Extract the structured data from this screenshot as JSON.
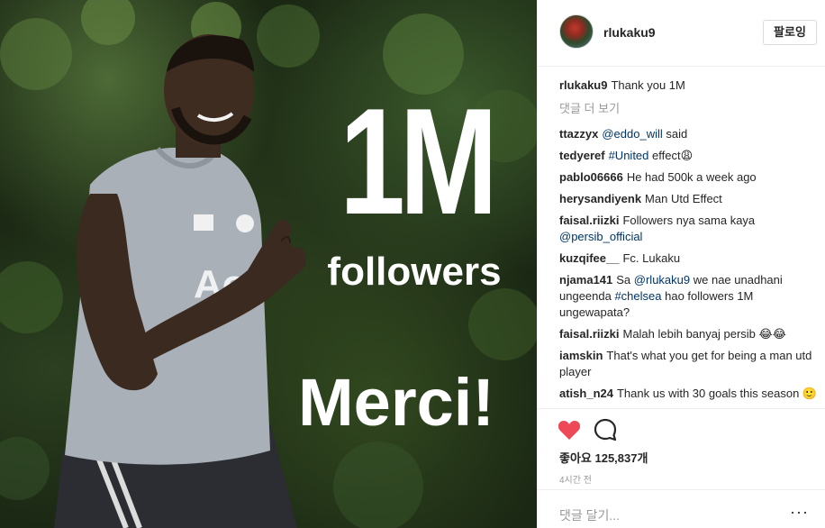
{
  "post_image": {
    "headline": "1M",
    "subline": "followers",
    "thanks": "Merci!"
  },
  "header": {
    "username": "rlukaku9",
    "follow_label": "팔로잉"
  },
  "caption": {
    "user": "rlukaku9",
    "text": "Thank you 1M"
  },
  "load_more_label": "댓글 더 보기",
  "comments": [
    {
      "user": "ttazzyx",
      "link": "@eddo_will",
      "text": " said"
    },
    {
      "user": "tedyeref",
      "link": "#United",
      "text": " effect😩"
    },
    {
      "user": "pablo06666",
      "link": "",
      "text": "He had 500k a week ago"
    },
    {
      "user": "herysandiyenk",
      "link": "",
      "text": "Man Utd Effect"
    },
    {
      "user": "faisal.riizki",
      "link": "",
      "text": "Followers nya sama kaya",
      "link2": "@persib_official"
    },
    {
      "user": "kuzqifee__",
      "link": "",
      "text": "Fc. Lukaku"
    },
    {
      "user": "njama141",
      "pre": "Sa ",
      "link": "@rlukaku9",
      "text": " we nae unadhani ungeenda ",
      "link2": "#chelsea",
      "text2": " hao followers 1M ungewapata?"
    },
    {
      "user": "faisal.riizki",
      "link": "",
      "text": "Malah lebih banyaj persib 😂😂"
    },
    {
      "user": "iamskin",
      "link": "",
      "text": "That's what you get for being a man utd player"
    },
    {
      "user": "atish_n24",
      "link": "",
      "text": "Thank us with 30 goals this season 🙂"
    }
  ],
  "actions": {
    "like_icon": "heart-icon",
    "comment_icon": "comment-icon",
    "likes_label": "좋아요 125,837개",
    "timestamp": "4시간 전"
  },
  "add_comment": {
    "placeholder": "댓글 달기...",
    "options": "···"
  },
  "colors": {
    "heart": "#ed4956",
    "link": "#003569",
    "muted": "#999999",
    "border": "#efefef"
  }
}
